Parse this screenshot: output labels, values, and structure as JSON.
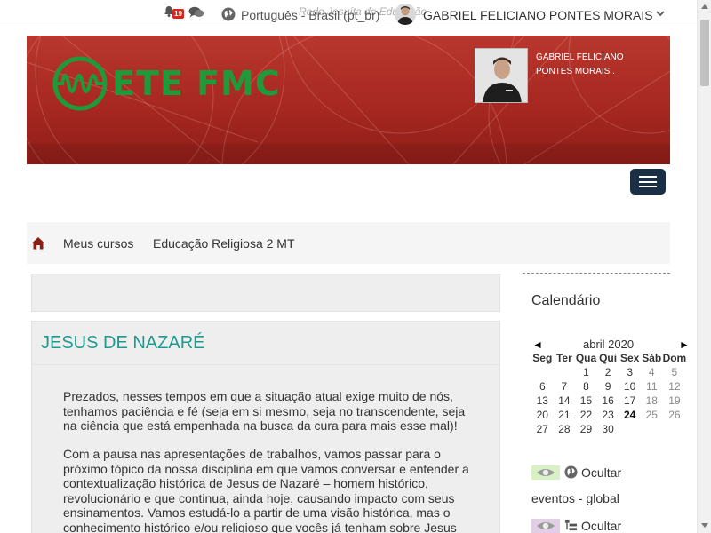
{
  "topbar": {
    "site_ghost_text": "Rede Jesuíta de Educação",
    "notification_count": "19",
    "language": "Português - Brasil (pt_br)",
    "username": "GABRIEL FELICIANO PONTES MORAIS"
  },
  "banner": {
    "logo_text": "ETE FMC",
    "user_name": "GABRIEL FELICIANO PONTES MORAIS ."
  },
  "breadcrumb": {
    "items": [
      "Meus cursos",
      "Educação Religiosa 2 MT"
    ]
  },
  "topic": {
    "title": "JESUS DE NAZARÉ",
    "paragraphs": [
      "Prezados, nesses tempos em que a situação atual exige muito de nós, tenhamos paciência e fé (seja em si mesmo, seja no transcendente, seja na ciência que está empenhada na busca da cura para mais esse mal)!",
      "Com a pausa nas apresentações de trabalhos, vamos passar para o próximo tópico da nossa disciplina em que vamos conversar e entender a contextualização histórica de Jesus de Nazaré – homem histórico, revolucionário e que continua, ainda hoje, causando impacto com seus ensinamentos. Vamos estudá-lo a partir de uma visão histórica, mas o conhecimento histórico e/ou religioso que vocês já tenham sobre Jesus"
    ]
  },
  "calendar": {
    "title": "Calendário",
    "month": "abril 2020",
    "prev": "◄",
    "next": "►",
    "weekdays": [
      "Seg",
      "Ter",
      "Qua",
      "Qui",
      "Sex",
      "Sáb",
      "Dom"
    ],
    "weeks": [
      [
        "",
        "",
        "1",
        "2",
        "3",
        "4",
        "5"
      ],
      [
        "6",
        "7",
        "8",
        "9",
        "10",
        "11",
        "12"
      ],
      [
        "13",
        "14",
        "15",
        "16",
        "17",
        "18",
        "19"
      ],
      [
        "20",
        "21",
        "22",
        "23",
        "24",
        "25",
        "26"
      ],
      [
        "27",
        "28",
        "29",
        "30",
        "",
        "",
        ""
      ]
    ],
    "today": "24"
  },
  "events": {
    "global_label": "Ocultar",
    "global_sub": "eventos - global",
    "category_label": "Ocultar",
    "global_color": "#d7f0c4",
    "category_color": "#e2cfe6"
  },
  "colors": {
    "banner_red": "#a72821",
    "logo_green": "#1f9a3a",
    "title_teal": "#1d9a8e",
    "nav_dark": "#1a2e45"
  }
}
